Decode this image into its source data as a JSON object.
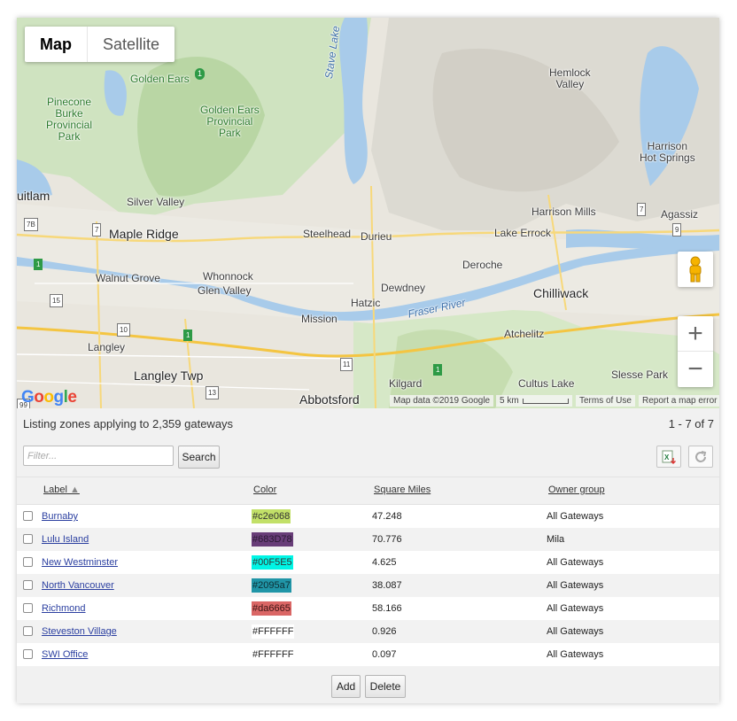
{
  "map": {
    "type_tabs": [
      "Map",
      "Satellite"
    ],
    "places": [
      {
        "name": "Golden Ears",
        "cls": "park"
      },
      {
        "name": "Pinecone\nBurke\nProvincial\nPark",
        "cls": "park"
      },
      {
        "name": "Golden Ears\nProvincial\nPark",
        "cls": "park"
      },
      {
        "name": "Stave Lake",
        "cls": "water"
      },
      {
        "name": "Hemlock\nValley",
        "cls": ""
      },
      {
        "name": "Harrison\nHot Springs",
        "cls": ""
      },
      {
        "name": "uitlam",
        "cls": "big"
      },
      {
        "name": "Silver Valley",
        "cls": ""
      },
      {
        "name": "Maple Ridge",
        "cls": "big"
      },
      {
        "name": "Steelhead",
        "cls": ""
      },
      {
        "name": "Durieu",
        "cls": ""
      },
      {
        "name": "Harrison Mills",
        "cls": ""
      },
      {
        "name": "Agassiz",
        "cls": ""
      },
      {
        "name": "Lake Errock",
        "cls": ""
      },
      {
        "name": "Walnut Grove",
        "cls": ""
      },
      {
        "name": "Whonnock",
        "cls": ""
      },
      {
        "name": "Glen Valley",
        "cls": ""
      },
      {
        "name": "Deroche",
        "cls": ""
      },
      {
        "name": "Dewdney",
        "cls": ""
      },
      {
        "name": "Chilliwack",
        "cls": "big"
      },
      {
        "name": "Hatzic",
        "cls": ""
      },
      {
        "name": "Mission",
        "cls": ""
      },
      {
        "name": "Fraser River",
        "cls": "water"
      },
      {
        "name": "Langley",
        "cls": ""
      },
      {
        "name": "Atchelitz",
        "cls": ""
      },
      {
        "name": "Langley Twp",
        "cls": "big"
      },
      {
        "name": "Kilgard",
        "cls": ""
      },
      {
        "name": "Cultus Lake",
        "cls": ""
      },
      {
        "name": "Slesse Park",
        "cls": ""
      },
      {
        "name": "Abbotsford",
        "cls": "big"
      }
    ],
    "route_badges": [
      "7B",
      "7",
      "7",
      "9",
      "15",
      "10",
      "1",
      "11",
      "13",
      "99",
      "1",
      "1",
      "1"
    ],
    "attribution": {
      "data": "Map data ©2019 Google",
      "scale": "5 km",
      "terms": "Terms of Use",
      "report": "Report a map error"
    },
    "logo": "Google",
    "zoom_in": "+",
    "zoom_out": "−"
  },
  "listing": {
    "summary": "Listing zones applying to 2,359 gateways",
    "range": "1 - 7 of 7"
  },
  "toolbar": {
    "filter_placeholder": "Filter...",
    "search_label": "Search"
  },
  "table": {
    "headers": {
      "label": "Label",
      "color": "Color",
      "square_miles": "Square Miles",
      "owner_group": "Owner group"
    },
    "rows": [
      {
        "label": "Burnaby",
        "color": "#c2e068",
        "sq": "47.248",
        "owner": "All Gateways",
        "fg": "#333"
      },
      {
        "label": "Lulu Island",
        "color": "#683D78",
        "sq": "70.776",
        "owner": "Mila",
        "fg": "#2a1a33"
      },
      {
        "label": "New Westminster",
        "color": "#00F5E5",
        "sq": "4.625",
        "owner": "All Gateways",
        "fg": "#333"
      },
      {
        "label": "North Vancouver",
        "color": "#2095a7",
        "sq": "38.087",
        "owner": "All Gateways",
        "fg": "#0d2f35"
      },
      {
        "label": "Richmond",
        "color": "#da6665",
        "sq": "58.166",
        "owner": "All Gateways",
        "fg": "#3b1515"
      },
      {
        "label": "Steveston Village",
        "color": "#FFFFFF",
        "sq": "0.926",
        "owner": "All Gateways",
        "fg": "#222"
      },
      {
        "label": "SWI Office",
        "color": "#FFFFFF",
        "sq": "0.097",
        "owner": "All Gateways",
        "fg": "#222"
      }
    ]
  },
  "footer": {
    "add_label": "Add",
    "delete_label": "Delete"
  }
}
